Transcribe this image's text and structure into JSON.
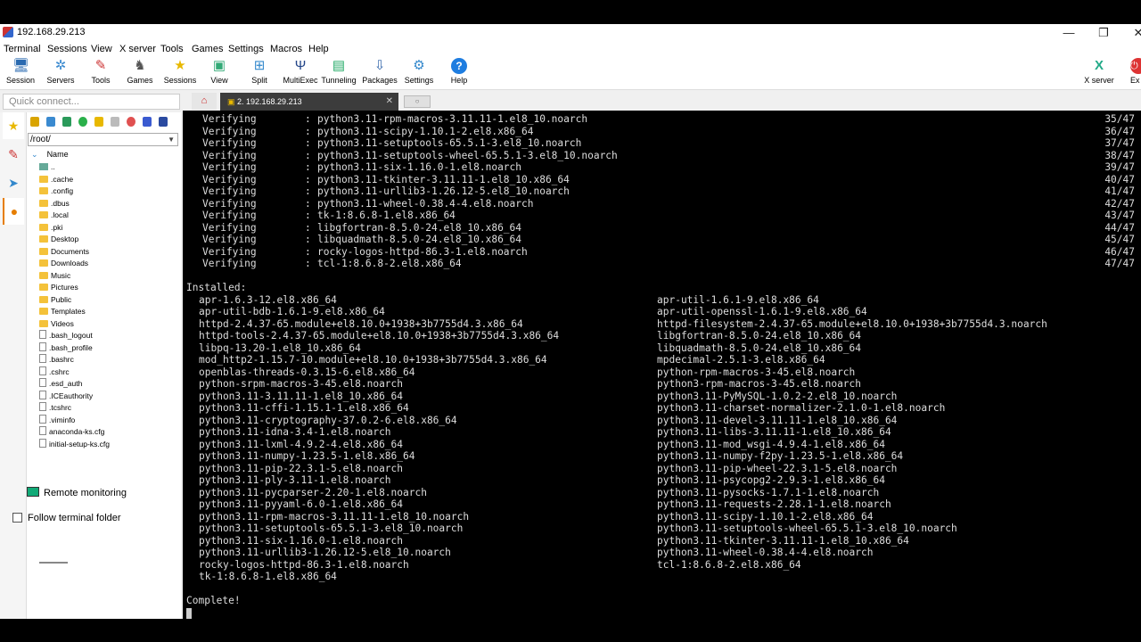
{
  "window": {
    "title": "192.168.29.213",
    "minimize": "—",
    "maximize": "❐",
    "close": "✕"
  },
  "menu": [
    "Terminal",
    "Sessions",
    "View",
    "X server",
    "Tools",
    "Games",
    "Settings",
    "Macros",
    "Help"
  ],
  "toolbar": {
    "items": [
      {
        "label": "Session",
        "icon": "session-icon"
      },
      {
        "label": "Servers",
        "icon": "servers-icon"
      },
      {
        "label": "Tools",
        "icon": "tools-icon"
      },
      {
        "label": "Games",
        "icon": "games-icon"
      },
      {
        "label": "Sessions",
        "icon": "star-icon"
      },
      {
        "label": "View",
        "icon": "view-icon"
      },
      {
        "label": "Split",
        "icon": "split-icon"
      },
      {
        "label": "MultiExec",
        "icon": "multiexec-icon"
      },
      {
        "label": "Tunneling",
        "icon": "tunneling-icon"
      },
      {
        "label": "Packages",
        "icon": "packages-icon"
      },
      {
        "label": "Settings",
        "icon": "gear-icon"
      },
      {
        "label": "Help",
        "icon": "help-icon"
      }
    ],
    "xserver_label": "X server",
    "exit_label": "Ex"
  },
  "quick_connect": {
    "placeholder": "Quick connect..."
  },
  "tabs": {
    "session_tab": "2. 192.168.29.213",
    "close": "✕",
    "new_tab": "○"
  },
  "sftp": {
    "path": "/root/",
    "column": "Name",
    "items": [
      {
        "name": "..",
        "type": "up"
      },
      {
        "name": ".cache",
        "type": "folder"
      },
      {
        "name": ".config",
        "type": "folder"
      },
      {
        "name": ".dbus",
        "type": "folder"
      },
      {
        "name": ".local",
        "type": "folder"
      },
      {
        "name": ".pki",
        "type": "folder"
      },
      {
        "name": "Desktop",
        "type": "folder"
      },
      {
        "name": "Documents",
        "type": "folder"
      },
      {
        "name": "Downloads",
        "type": "folder"
      },
      {
        "name": "Music",
        "type": "folder"
      },
      {
        "name": "Pictures",
        "type": "folder"
      },
      {
        "name": "Public",
        "type": "folder"
      },
      {
        "name": "Templates",
        "type": "folder"
      },
      {
        "name": "Videos",
        "type": "folder"
      },
      {
        "name": ".bash_logout",
        "type": "file"
      },
      {
        "name": ".bash_profile",
        "type": "file"
      },
      {
        "name": ".bashrc",
        "type": "file"
      },
      {
        "name": ".cshrc",
        "type": "file"
      },
      {
        "name": ".esd_auth",
        "type": "file"
      },
      {
        "name": ".ICEauthority",
        "type": "file"
      },
      {
        "name": ".tcshrc",
        "type": "file"
      },
      {
        "name": ".viminfo",
        "type": "file"
      },
      {
        "name": "anaconda-ks.cfg",
        "type": "file"
      },
      {
        "name": "initial-setup-ks.cfg",
        "type": "file"
      }
    ],
    "remote_monitoring": "Remote monitoring",
    "follow_terminal": "Follow terminal folder"
  },
  "terminal": {
    "verifying": [
      {
        "word": "Verifying",
        "pkg": "python3.11-rpm-macros-3.11.11-1.el8_10.noarch",
        "count": "35/47"
      },
      {
        "word": "Verifying",
        "pkg": "python3.11-scipy-1.10.1-2.el8.x86_64",
        "count": "36/47"
      },
      {
        "word": "Verifying",
        "pkg": "python3.11-setuptools-65.5.1-3.el8_10.noarch",
        "count": "37/47"
      },
      {
        "word": "Verifying",
        "pkg": "python3.11-setuptools-wheel-65.5.1-3.el8_10.noarch",
        "count": "38/47"
      },
      {
        "word": "Verifying",
        "pkg": "python3.11-six-1.16.0-1.el8.noarch",
        "count": "39/47"
      },
      {
        "word": "Verifying",
        "pkg": "python3.11-tkinter-3.11.11-1.el8_10.x86_64",
        "count": "40/47"
      },
      {
        "word": "Verifying",
        "pkg": "python3.11-urllib3-1.26.12-5.el8_10.noarch",
        "count": "41/47"
      },
      {
        "word": "Verifying",
        "pkg": "python3.11-wheel-0.38.4-4.el8.noarch",
        "count": "42/47"
      },
      {
        "word": "Verifying",
        "pkg": "tk-1:8.6.8-1.el8.x86_64",
        "count": "43/47"
      },
      {
        "word": "Verifying",
        "pkg": "libgfortran-8.5.0-24.el8_10.x86_64",
        "count": "44/47"
      },
      {
        "word": "Verifying",
        "pkg": "libquadmath-8.5.0-24.el8_10.x86_64",
        "count": "45/47"
      },
      {
        "word": "Verifying",
        "pkg": "rocky-logos-httpd-86.3-1.el8.noarch",
        "count": "46/47"
      },
      {
        "word": "Verifying",
        "pkg": "tcl-1:8.6.8-2.el8.x86_64",
        "count": "47/47"
      }
    ],
    "installed_header": "Installed:",
    "installed_left": [
      "apr-1.6.3-12.el8.x86_64",
      "apr-util-bdb-1.6.1-9.el8.x86_64",
      "httpd-2.4.37-65.module+el8.10.0+1938+3b7755d4.3.x86_64",
      "httpd-tools-2.4.37-65.module+el8.10.0+1938+3b7755d4.3.x86_64",
      "libpq-13.20-1.el8_10.x86_64",
      "mod_http2-1.15.7-10.module+el8.10.0+1938+3b7755d4.3.x86_64",
      "openblas-threads-0.3.15-6.el8.x86_64",
      "python-srpm-macros-3-45.el8.noarch",
      "python3.11-3.11.11-1.el8_10.x86_64",
      "python3.11-cffi-1.15.1-1.el8.x86_64",
      "python3.11-cryptography-37.0.2-6.el8.x86_64",
      "python3.11-idna-3.4-1.el8.noarch",
      "python3.11-lxml-4.9.2-4.el8.x86_64",
      "python3.11-numpy-1.23.5-1.el8.x86_64",
      "python3.11-pip-22.3.1-5.el8.noarch",
      "python3.11-ply-3.11-1.el8.noarch",
      "python3.11-pycparser-2.20-1.el8.noarch",
      "python3.11-pyyaml-6.0-1.el8.x86_64",
      "python3.11-rpm-macros-3.11.11-1.el8_10.noarch",
      "python3.11-setuptools-65.5.1-3.el8_10.noarch",
      "python3.11-six-1.16.0-1.el8.noarch",
      "python3.11-urllib3-1.26.12-5.el8_10.noarch",
      "rocky-logos-httpd-86.3-1.el8.noarch",
      "tk-1:8.6.8-1.el8.x86_64"
    ],
    "installed_right": [
      "apr-util-1.6.1-9.el8.x86_64",
      "apr-util-openssl-1.6.1-9.el8.x86_64",
      "httpd-filesystem-2.4.37-65.module+el8.10.0+1938+3b7755d4.3.noarch",
      "libgfortran-8.5.0-24.el8_10.x86_64",
      "libquadmath-8.5.0-24.el8_10.x86_64",
      "mpdecimal-2.5.1-3.el8.x86_64",
      "python-rpm-macros-3-45.el8.noarch",
      "python3-rpm-macros-3-45.el8.noarch",
      "python3.11-PyMySQL-1.0.2-2.el8_10.noarch",
      "python3.11-charset-normalizer-2.1.0-1.el8.noarch",
      "python3.11-devel-3.11.11-1.el8_10.x86_64",
      "python3.11-libs-3.11.11-1.el8_10.x86_64",
      "python3.11-mod_wsgi-4.9.4-1.el8.x86_64",
      "python3.11-numpy-f2py-1.23.5-1.el8.x86_64",
      "python3.11-pip-wheel-22.3.1-5.el8.noarch",
      "python3.11-psycopg2-2.9.3-1.el8.x86_64",
      "python3.11-pysocks-1.7.1-1.el8.noarch",
      "python3.11-requests-2.28.1-1.el8.noarch",
      "python3.11-scipy-1.10.1-2.el8.x86_64",
      "python3.11-setuptools-wheel-65.5.1-3.el8_10.noarch",
      "python3.11-tkinter-3.11.11-1.el8_10.x86_64",
      "python3.11-wheel-0.38.4-4.el8.noarch",
      "tcl-1:8.6.8-2.el8.x86_64"
    ],
    "complete": "Complete!"
  }
}
